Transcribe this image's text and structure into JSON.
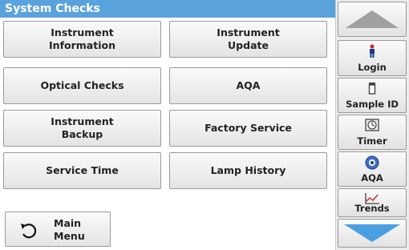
{
  "title": "System Checks",
  "grid_buttons": [
    {
      "label": "Instrument\nInformation"
    },
    {
      "label": "Instrument\nUpdate"
    },
    {
      "label": "Optical Checks"
    },
    {
      "label": "AQA"
    },
    {
      "label": "Instrument\nBackup"
    },
    {
      "label": "Factory Service"
    },
    {
      "label": "Service Time"
    },
    {
      "label": "Lamp History"
    }
  ],
  "main_menu": {
    "label": "Main\nMenu",
    "icon": "back-arrow-icon"
  },
  "sidebar": {
    "items": [
      {
        "label": "Login",
        "icon": "login-person-icon"
      },
      {
        "label": "Sample ID",
        "icon": "sample-vial-icon"
      },
      {
        "label": "Timer",
        "icon": "timer-icon"
      },
      {
        "label": "AQA",
        "icon": "aqa-icon"
      },
      {
        "label": "Trends",
        "icon": "trends-chart-icon"
      }
    ],
    "scroll_up_icon": "triangle-up-icon",
    "scroll_down_icon": "triangle-down-icon"
  },
  "colors": {
    "title_bar": "#5aa2dc",
    "scroll_up": "#9a9a9a",
    "scroll_down": "#4a9fe0"
  }
}
